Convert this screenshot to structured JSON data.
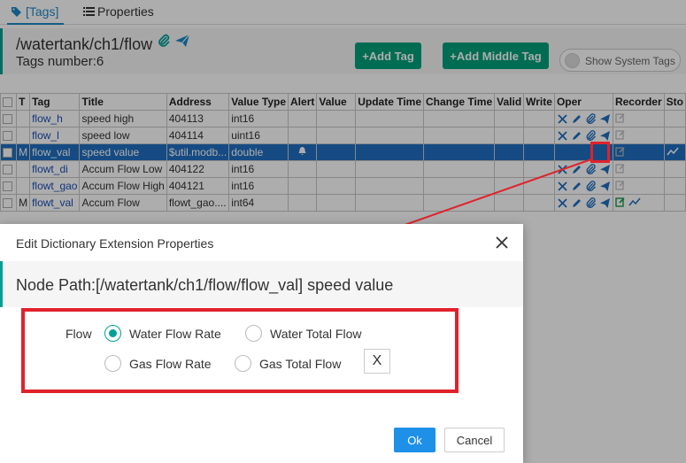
{
  "tabs": {
    "tags_label": "[Tags]",
    "properties_label": "Properties"
  },
  "header": {
    "path": "/watertank/ch1/flow",
    "tags_number": "Tags number:6"
  },
  "toolbar": {
    "add_tag": "+Add Tag",
    "add_middle_tag": "+Add Middle Tag",
    "show_system_tags": "Show System Tags"
  },
  "table": {
    "headers": [
      "",
      "T",
      "Tag",
      "Title",
      "Address",
      "Value Type",
      "Alert",
      "Value",
      "Update Time",
      "Change Time",
      "Valid",
      "Write",
      "Oper",
      "Recorder",
      "Sto"
    ],
    "rows": [
      {
        "t": "",
        "tag": "flow_h",
        "title": "speed high",
        "address": "404113",
        "type": "int16",
        "alert": false,
        "selected": false
      },
      {
        "t": "",
        "tag": "flow_l",
        "title": "speed low",
        "address": "404114",
        "type": "uint16",
        "alert": false,
        "selected": false
      },
      {
        "t": "M",
        "tag": "flow_val",
        "title": "speed value",
        "address": "$util.modb...",
        "type": "double",
        "alert": true,
        "selected": true
      },
      {
        "t": "",
        "tag": "flowt_di",
        "title": "Accum Flow Low",
        "address": "404122",
        "type": "int16",
        "alert": false,
        "selected": false
      },
      {
        "t": "",
        "tag": "flowt_gao",
        "title": "Accum Flow High",
        "address": "404121",
        "type": "int16",
        "alert": false,
        "selected": false
      },
      {
        "t": "M",
        "tag": "flowt_val",
        "title": "Accum Flow",
        "address": "flowt_gao....",
        "type": "int64",
        "alert": false,
        "selected": false
      }
    ]
  },
  "modal": {
    "title": "Edit Dictionary Extension Properties",
    "node_path": "Node Path:[/watertank/ch1/flow/flow_val] speed value",
    "flow_label": "Flow",
    "options": [
      "Water Flow Rate",
      "Water Total Flow",
      "Gas Flow Rate",
      "Gas Total Flow"
    ],
    "selected_option": "Water Flow Rate",
    "clear_label": "X",
    "ok_label": "Ok",
    "cancel_label": "Cancel"
  },
  "colors": {
    "accent": "#00a098",
    "primary_blue": "#1e90e8",
    "selected_row": "#1f6fc0",
    "annotation_red": "#e0222b"
  }
}
